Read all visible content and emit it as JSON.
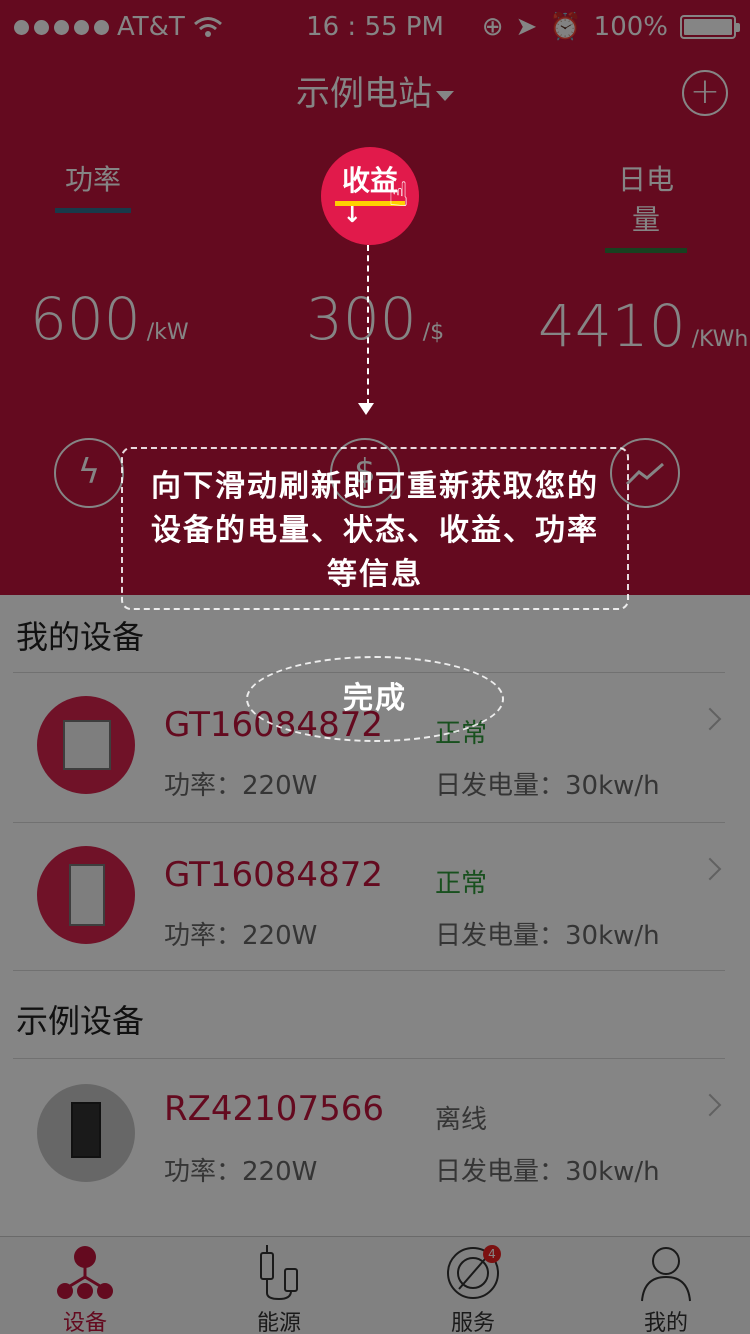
{
  "status_bar": {
    "carrier": "AT&T",
    "time": "16 : 55 PM",
    "battery": "100%"
  },
  "header": {
    "station": "示例电站",
    "tabs": {
      "power": "功率",
      "income": "收益",
      "daily": "日电量"
    },
    "stats": {
      "power": {
        "value": "600",
        "unit": "/kW"
      },
      "income": {
        "value": "300",
        "unit": "/$"
      },
      "daily": {
        "value": "4410",
        "unit": "/KWh"
      }
    }
  },
  "sections": {
    "my_devices": "我的设备",
    "sample_devices": "示例设备"
  },
  "devices": [
    {
      "name": "GT16084872",
      "status": "正常",
      "power": "功率：220W",
      "daily": "日发电量：30kw/h"
    },
    {
      "name": "GT16084872",
      "status": "正常",
      "power": "功率：220W",
      "daily": "日发电量：30kw/h"
    },
    {
      "name": "RZ42107566",
      "status": "离线",
      "power": "功率：220W",
      "daily": "日发电量：30kw/h"
    }
  ],
  "tabbar": {
    "items": [
      {
        "label": "设备",
        "icon": "device-icon"
      },
      {
        "label": "能源",
        "icon": "energy-icon"
      },
      {
        "label": "服务",
        "icon": "service-icon",
        "badge": "4"
      },
      {
        "label": "我的",
        "icon": "profile-icon"
      }
    ]
  },
  "overlay": {
    "hint": "向下滑动刷新即可重新获取您的设备的电量、状态、收益、功率等信息",
    "done": "完成",
    "circle_label": "收益"
  },
  "colors": {
    "brand": "#c0143c",
    "ok": "#2e9a3a",
    "accent_yellow": "#ffd000"
  }
}
